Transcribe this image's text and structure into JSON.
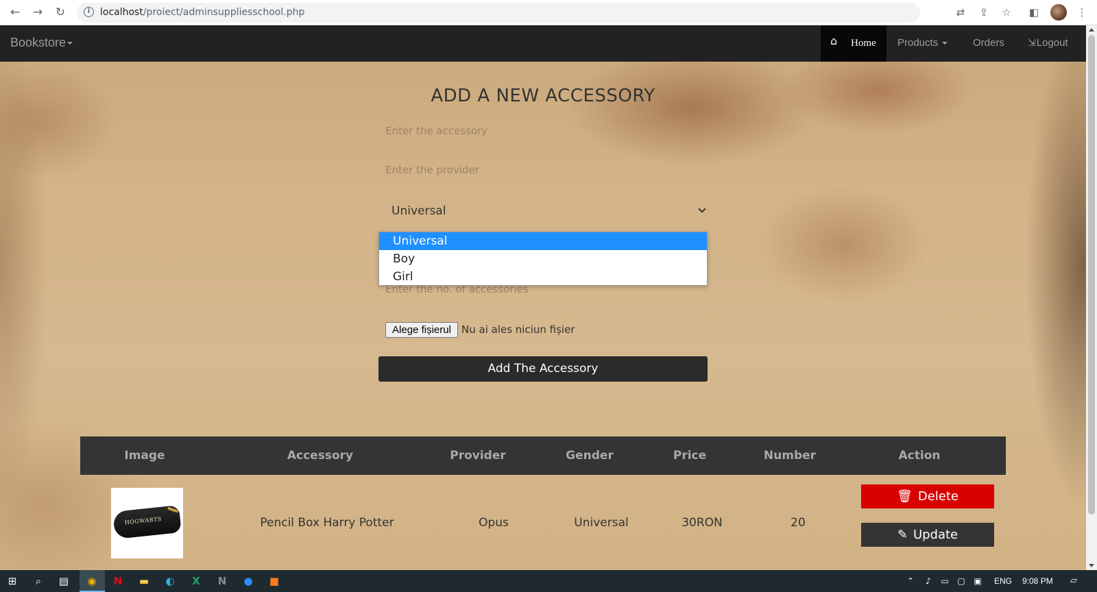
{
  "browser": {
    "url_host": "localhost",
    "url_path": "/proiect/adminsuppliesschool.php",
    "back_glyph": "←",
    "forward_glyph": "→",
    "reload_glyph": "↻",
    "info_glyph": "i",
    "translate_glyph": "⇄",
    "share_glyph": "⇪",
    "star_glyph": "☆",
    "sidepanel_glyph": "◧",
    "menu_glyph": "⋮"
  },
  "navbar": {
    "brand": "Bookstore",
    "home_label": "Home",
    "home_icon": "⌂",
    "products_label": "Products",
    "orders_label": "Orders",
    "logout_label": "Logout",
    "logout_icon": "⇲"
  },
  "form": {
    "title": "ADD A NEW ACCESSORY",
    "accessory_placeholder": "Enter the accessory",
    "provider_placeholder": "Enter the provider",
    "gender_selected": "Universal",
    "gender_options": [
      "Universal",
      "Boy",
      "Girl"
    ],
    "number_placeholder": "Enter the no. of accessories",
    "file_button": "Alege fișierul",
    "file_status": "Nu ai ales niciun fișier",
    "submit_label": "Add The Accessory"
  },
  "table": {
    "headers": [
      "Image",
      "Accessory",
      "Provider",
      "Gender",
      "Price",
      "Number",
      "Action"
    ],
    "rows": [
      {
        "image_logo": "HOGWARTS",
        "accessory": "Pencil Box Harry Potter",
        "provider": "Opus",
        "gender": "Universal",
        "price": "30RON",
        "number": "20",
        "delete_label": "Delete",
        "update_label": "Update"
      }
    ],
    "delete_icon": "🗑",
    "update_icon": "✎"
  },
  "taskbar": {
    "language": "ENG",
    "time": "9:08 PM"
  },
  "colors": {
    "navbar_bg": "#222222",
    "delete_red": "#d90000",
    "dropdown_highlight": "#1e90ff",
    "table_head_bg": "#343434"
  }
}
